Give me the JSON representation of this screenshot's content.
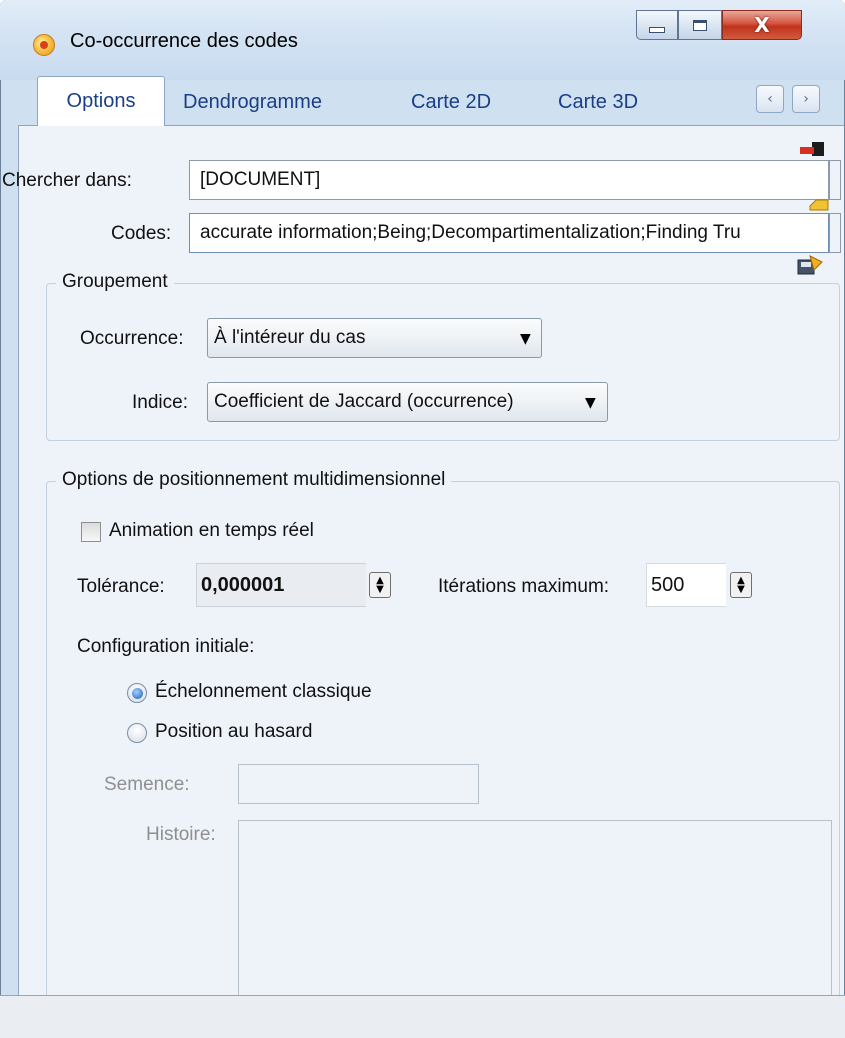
{
  "window": {
    "title": "Co-occurrence des codes",
    "close_glyph": "X"
  },
  "tabs": [
    {
      "label": "Options",
      "active": true
    },
    {
      "label": "Dendrogramme",
      "active": false
    },
    {
      "label": "Carte 2D",
      "active": false
    },
    {
      "label": "Carte 3D",
      "active": false
    }
  ],
  "tab_scroll": {
    "left_glyph": "‹",
    "right_glyph": "›"
  },
  "search": {
    "label": "Chercher dans:",
    "value": "[DOCUMENT]"
  },
  "codes": {
    "label": "Codes:",
    "value": "accurate information;Being;Decompartimentalization;Finding Tru"
  },
  "grouping": {
    "legend": "Groupement",
    "occurrence_label": "Occurrence:",
    "occurrence_value": "À l'intéreur du cas",
    "index_label": "Indice:",
    "index_value": "Coefficient de Jaccard (occurrence)"
  },
  "mds": {
    "legend": "Options de positionnement multidimensionnel",
    "animation_label": "Animation en temps réel",
    "animation_checked": false,
    "tolerance_label": "Tolérance:",
    "tolerance_value": "0,000001",
    "iterations_label": "Itérations maximum:",
    "iterations_value": "500",
    "initial_config_label": "Configuration initiale:",
    "options": [
      {
        "label": "Échelonnement classique",
        "checked": true
      },
      {
        "label": "Position au hasard",
        "checked": false
      }
    ],
    "seed_label": "Semence:",
    "seed_value": "",
    "history_label": "Histoire:",
    "history_value": ""
  },
  "colors": {
    "tab_text": "#1a3f86",
    "frame": "#cfe0f1",
    "page": "#eef3f9"
  }
}
